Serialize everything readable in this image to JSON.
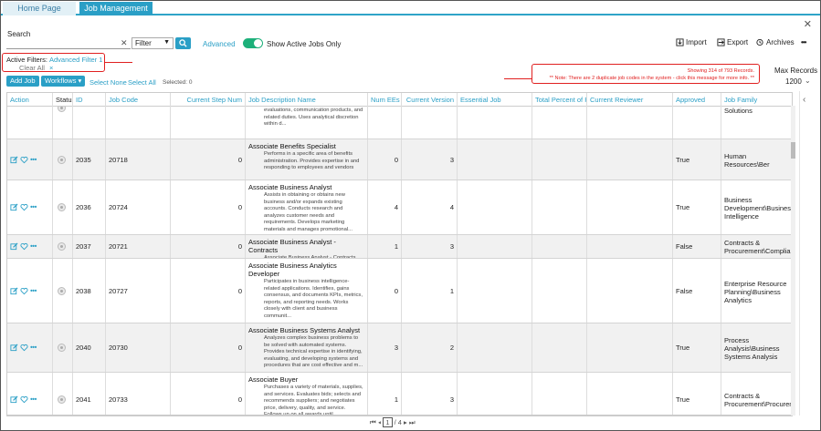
{
  "tabs": [
    {
      "label": "Home Page"
    },
    {
      "label": "Job Management"
    }
  ],
  "search": {
    "label": "Search",
    "value": "",
    "filter_value": "Filter",
    "advanced_label": "Advanced"
  },
  "toggle": {
    "label": "Show Active Jobs Only",
    "state": "on"
  },
  "toolbar": {
    "import_label": "Import",
    "export_label": "Export",
    "archives_label": "Archives",
    "more": "•••"
  },
  "active_filters": {
    "label": "Active Filters:",
    "filter_name": "Advanced Filter 1",
    "filter_remove": "×",
    "clear_label": "Clear All"
  },
  "notice": {
    "showing": "Showing 314 of 793 Records.",
    "note": "** Note: There are 2 duplicate job codes in the system - click this message for more info. **"
  },
  "max_records": {
    "label": "Max Records",
    "value": "1200"
  },
  "actions": {
    "add_job": "Add Job",
    "workflows": "Workflows",
    "select_none": "Select None",
    "select_all": "Select All",
    "selected": "Selected: 0"
  },
  "columns": {
    "action": "Action",
    "status": "Status",
    "id": "ID",
    "job_code": "Job Code",
    "current_step": "Current Step Num",
    "job_desc": "Job Description Name",
    "num_ees": "Num EEs",
    "current_version": "Current Version",
    "essential_job": "Essential Job",
    "total_percent": "Total Percent of R",
    "current_reviewer": "Current Reviewer",
    "approved": "Approved",
    "job_family": "Job Family"
  },
  "partial_row": {
    "desc": "evaluations, communication products, and related duties. Uses analytical discretion within d...",
    "family": "Solutions"
  },
  "rows": [
    {
      "id": "2035",
      "code": "20718",
      "step": "0",
      "title": "Associate Benefits Specialist",
      "desc": "Performs in a specific area of benefits administration. Provides expertise in and responding to employees and vendors",
      "ees": "0",
      "version": "3",
      "approved": "True",
      "family": "Human Resources\\Ber"
    },
    {
      "id": "2036",
      "code": "20724",
      "step": "0",
      "title": "Associate Business Analyst",
      "desc": "Assists in obtaining or obtains new business and/or expands existing accounts. Conducts research and analyzes customer needs and requirements. Develops marketing materials and manages promotional...",
      "ees": "4",
      "version": "4",
      "approved": "True",
      "family": "Business Development\\Business Intelligence"
    },
    {
      "id": "2037",
      "code": "20721",
      "step": "0",
      "title": "Associate Business Analyst - Contracts",
      "desc": "Associate Business Analyst - Contracts",
      "ees": "1",
      "version": "3",
      "approved": "False",
      "family": "Contracts & Procurement\\Complian"
    },
    {
      "id": "2038",
      "code": "20727",
      "step": "0",
      "title": "Associate Business Analytics Developer",
      "desc": "Participates in business intelligence-related applications. Identifies, gains consensus, and documents KPIs, metrics, reports, and reporting needs. Works closely with client and business communit...",
      "ees": "0",
      "version": "1",
      "approved": "False",
      "family": "Enterprise Resource Planning\\Business Analytics"
    },
    {
      "id": "2040",
      "code": "20730",
      "step": "0",
      "title": "Associate Business Systems Analyst",
      "desc": "Analyzes complex business problems to be solved with automated systems. Provides technical expertise in identifying, evaluating, and developing systems and procedures that are cost effective and m...",
      "ees": "3",
      "version": "2",
      "approved": "True",
      "family": "Process Analysis\\Business Systems Analysis"
    },
    {
      "id": "2041",
      "code": "20733",
      "step": "0",
      "title": "Associate Buyer",
      "desc": "Purchases a variety of materials, supplies, and services. Evaluates bids; selects and recommends suppliers; and negotiates price, delivery, quality, and service. Follows up on all awards until",
      "ees": "1",
      "version": "3",
      "approved": "True",
      "family": "Contracts & Procurement\\Procuren"
    }
  ],
  "pager": {
    "current": "1",
    "total": "/ 4"
  }
}
